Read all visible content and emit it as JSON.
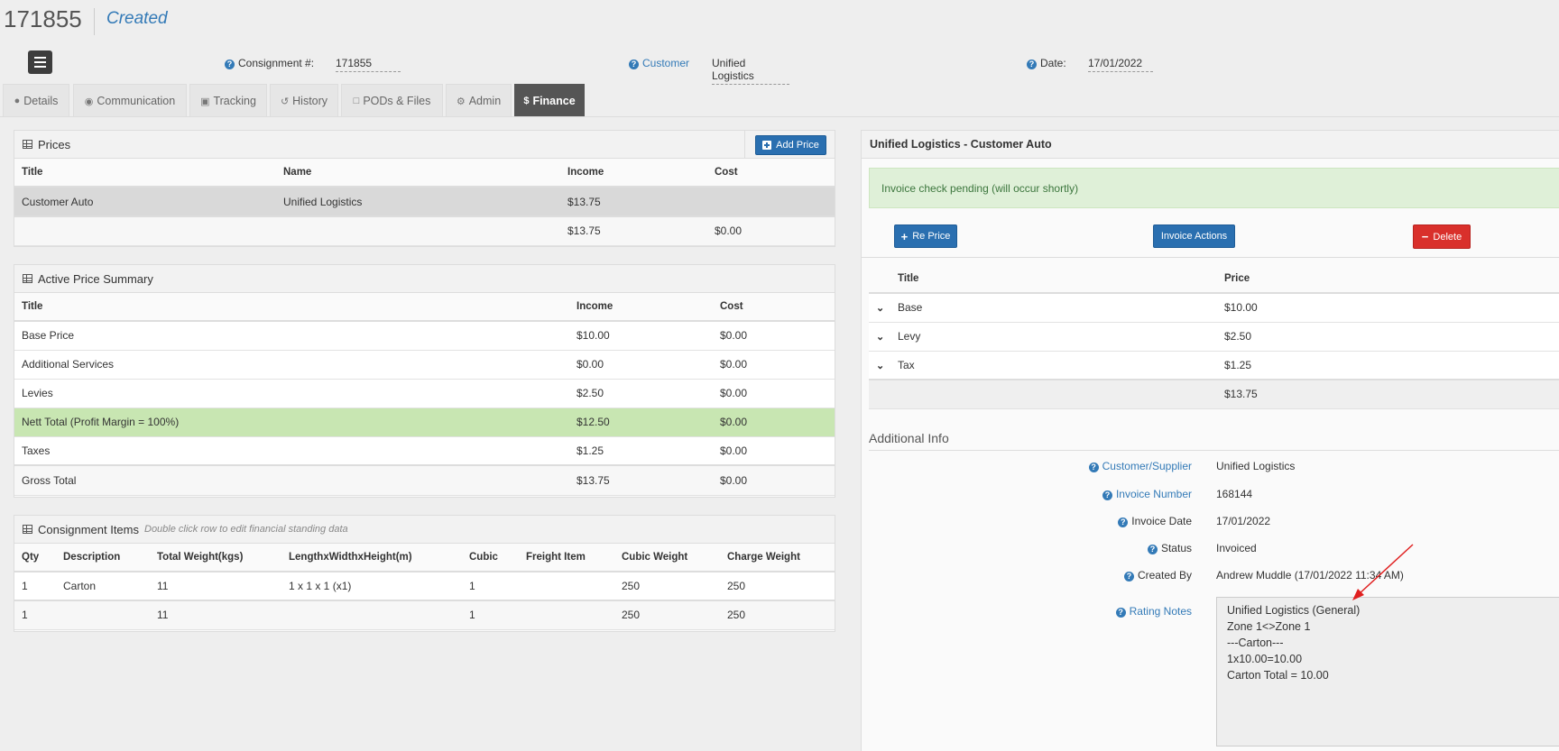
{
  "header": {
    "consignment_id": "171855",
    "status": "Created",
    "fields": {
      "consignment_label": "Consignment #:",
      "consignment_value": "171855",
      "customer_label": "Customer",
      "customer_value": "Unified Logistics",
      "date_label": "Date:",
      "date_value": "17/01/2022"
    }
  },
  "tabs": [
    {
      "label": "Details",
      "icon": "user-icon"
    },
    {
      "label": "Communication",
      "icon": "comment-icon"
    },
    {
      "label": "Tracking",
      "icon": "truck-icon"
    },
    {
      "label": "History",
      "icon": "history-icon"
    },
    {
      "label": "PODs & Files",
      "icon": "file-icon"
    },
    {
      "label": "Admin",
      "icon": "gear-icon"
    },
    {
      "label": "Finance",
      "icon": "dollar-icon",
      "active": true
    }
  ],
  "prices": {
    "title": "Prices",
    "add_button": "Add Price",
    "columns": [
      "Title",
      "Name",
      "Income",
      "Cost"
    ],
    "rows": [
      {
        "title": "Customer Auto",
        "name": "Unified Logistics",
        "income": "$13.75",
        "cost": ""
      }
    ],
    "total": {
      "income": "$13.75",
      "cost": "$0.00"
    }
  },
  "summary": {
    "title": "Active Price Summary",
    "columns": [
      "Title",
      "Income",
      "Cost"
    ],
    "rows": [
      {
        "title": "Base Price",
        "income": "$10.00",
        "cost": "$0.00"
      },
      {
        "title": "Additional Services",
        "income": "$0.00",
        "cost": "$0.00"
      },
      {
        "title": "Levies",
        "income": "$2.50",
        "cost": "$0.00"
      },
      {
        "title": "Nett Total (Profit Margin = 100%)",
        "income": "$12.50",
        "cost": "$0.00"
      },
      {
        "title": "Taxes",
        "income": "$1.25",
        "cost": "$0.00"
      }
    ],
    "gross": {
      "title": "Gross Total",
      "income": "$13.75",
      "cost": "$0.00"
    }
  },
  "items": {
    "title": "Consignment Items",
    "note": "Double click row to edit financial standing data",
    "columns": [
      "Qty",
      "Description",
      "Total Weight(kgs)",
      "LengthxWidthxHeight(m)",
      "Cubic",
      "Freight Item",
      "Cubic Weight",
      "Charge Weight"
    ],
    "rows": [
      {
        "qty": "1",
        "description": "Carton",
        "weight": "11",
        "dims": "1 x 1 x 1 (x1)",
        "cubic": "1",
        "freight": "",
        "cubic_weight": "250",
        "charge_weight": "250"
      }
    ],
    "total": {
      "qty": "1",
      "weight": "11",
      "cubic": "1",
      "cubic_weight": "250",
      "charge_weight": "250"
    }
  },
  "detail": {
    "title": "Unified Logistics - Customer Auto",
    "alert": "Invoice check pending (will occur shortly)",
    "buttons": {
      "reprice": "Re Price",
      "invoice_actions": "Invoice Actions",
      "delete": "Delete"
    },
    "columns": [
      "Title",
      "Price"
    ],
    "rows": [
      {
        "title": "Base",
        "price": "$10.00"
      },
      {
        "title": "Levy",
        "price": "$2.50"
      },
      {
        "title": "Tax",
        "price": "$1.25"
      }
    ],
    "total": "$13.75"
  },
  "additional": {
    "title": "Additional Info",
    "fields": [
      {
        "label": "Customer/Supplier",
        "value": "Unified Logistics"
      },
      {
        "label": "Invoice Number",
        "value": "168144"
      },
      {
        "label": "Invoice Date",
        "value": "17/01/2022"
      },
      {
        "label": "Status",
        "value": "Invoiced"
      },
      {
        "label": "Created By",
        "value": "Andrew Muddle (17/01/2022 11:34 AM)"
      }
    ],
    "notes_label": "Rating Notes",
    "notes": "Unified Logistics (General)\nZone 1<>Zone 1\n---Carton---\n1x10.00=10.00\nCarton Total = 10.00"
  },
  "colors": {
    "accent": "#337ab7",
    "button_blue": "#2a6fb0",
    "danger": "#d9302b",
    "success_row": "#c8e6b2",
    "annotation_arrow": "#e02020"
  }
}
